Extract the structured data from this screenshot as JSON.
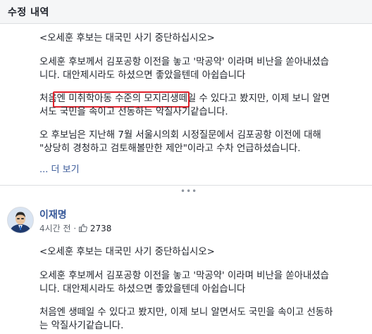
{
  "header": {
    "title": "수정 내역"
  },
  "revision": {
    "line1": "<오세훈 후보는 대국민 사기 중단하십시오>",
    "para1_line1": "오세훈 후보께서 김포공항 이전을 놓고 '막공약' 이라며 비난을 쏟아내셨습",
    "para1_line2": "니다. 대안제시라도 하셨으면 좋았을텐데 아쉽습니다",
    "para2_line1_pre": "처음엔 ",
    "para2_line1_hl": "미취학아동 수준의 모지리",
    "para2_line1_post": "생떼일 수 있다고 봤지만, 이제 보니 알면",
    "para2_line2": "서도 국민을 속이고 선동하는 악질사기같습니다.",
    "para3_line1": "오 후보님은 지난해 7월 서울시의회 시정질문에서 김포공항 이전에 대해",
    "para3_line2": "\"상당히 경청하고 검토해볼만한 제안\"이라고 수차 언급하셨습니다.",
    "more": "... 더 보기"
  },
  "post": {
    "author": "이재명",
    "time": "4시간 전",
    "likes": "2738",
    "line1": "<오세훈 후보는 대국민 사기 중단하십시오>",
    "para1_line1": "오세훈 후보께서 김포공항 이전을 놓고 '막공약' 이라며 비난을 쏟아내셨습",
    "para1_line2": "니다. 대안제시라도 하셨으면 좋았을텐데 아쉽습니다",
    "para2_line1": "처음엔 생떼일 수 있다고 봤지만, 이제 보니 알면서도 국민을 속이고 선동하",
    "para2_line2": "는 악질사기같습니다."
  },
  "colors": {
    "link": "#385898",
    "highlight": "#e0202a",
    "header_bg": "#f5f6f7"
  },
  "icons": {
    "separator": "dots-icon",
    "privacy": "globe-icon",
    "reaction": "like-icon"
  }
}
